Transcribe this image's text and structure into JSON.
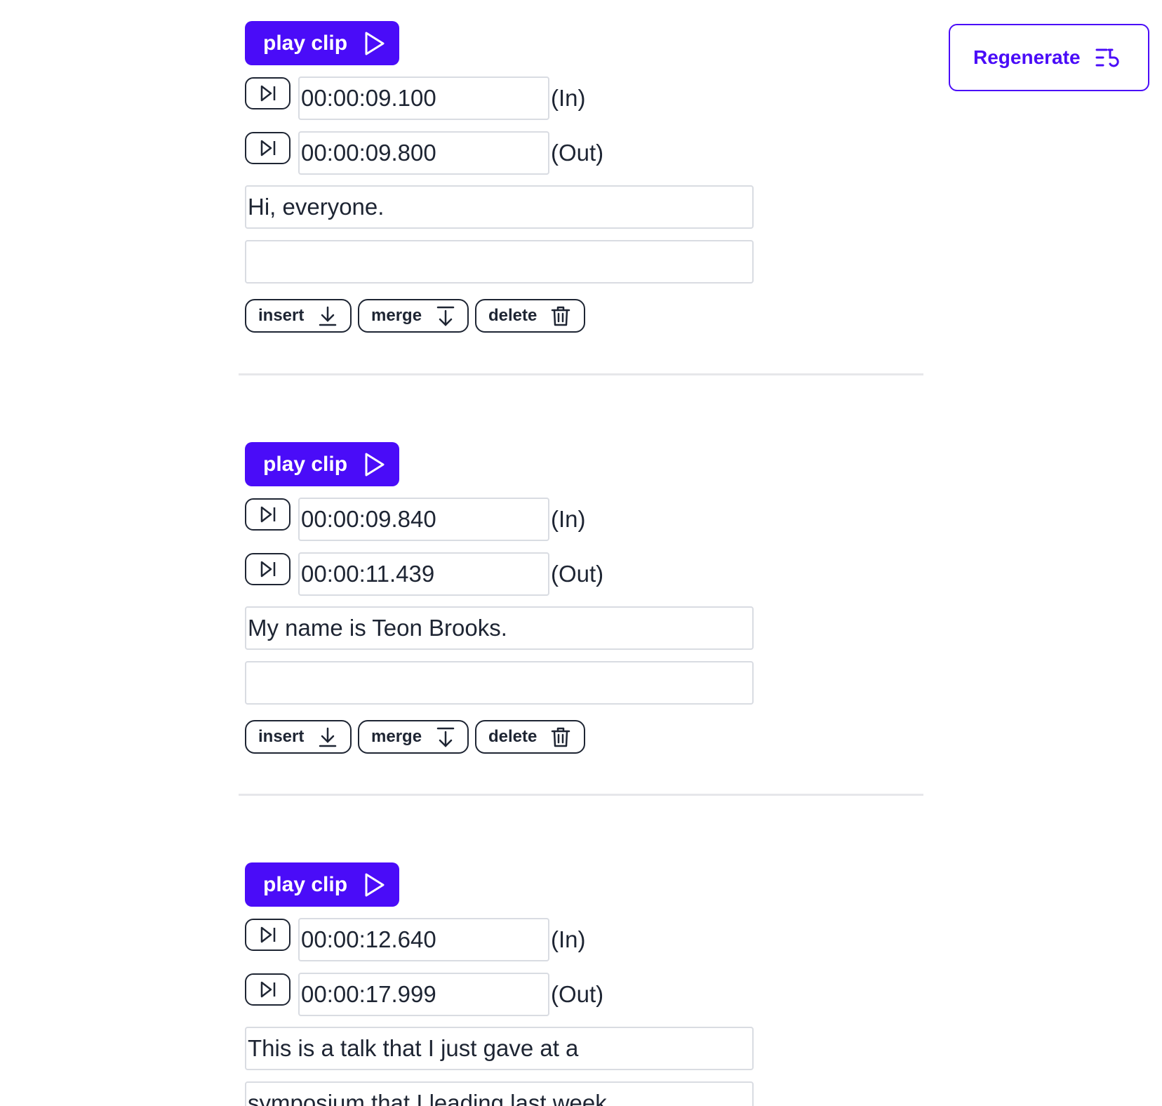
{
  "regenerate": {
    "label": "Regenerate",
    "icon": "list-restart-icon"
  },
  "segments": [
    {
      "play_label": "play clip",
      "in_time": "00:00:09.100",
      "in_label": "(In)",
      "out_time": "00:00:09.800",
      "out_label": "(Out)",
      "text_line1": "Hi, everyone.",
      "text_line2": "",
      "actions": {
        "insert": "insert",
        "merge": "merge",
        "delete": "delete"
      }
    },
    {
      "play_label": "play clip",
      "in_time": "00:00:09.840",
      "in_label": "(In)",
      "out_time": "00:00:11.439",
      "out_label": "(Out)",
      "text_line1": "My name is Teon Brooks.",
      "text_line2": "",
      "actions": {
        "insert": "insert",
        "merge": "merge",
        "delete": "delete"
      }
    },
    {
      "play_label": "play clip",
      "in_time": "00:00:12.640",
      "in_label": "(In)",
      "out_time": "00:00:17.999",
      "out_label": "(Out)",
      "text_line1": "This is a talk that I just gave at a",
      "text_line2": "symposium that I leading last week"
    }
  ],
  "colors": {
    "accent": "#4a0cf8",
    "text": "#1e2533",
    "border": "#d9dce2",
    "divider": "#e6e7ea"
  }
}
